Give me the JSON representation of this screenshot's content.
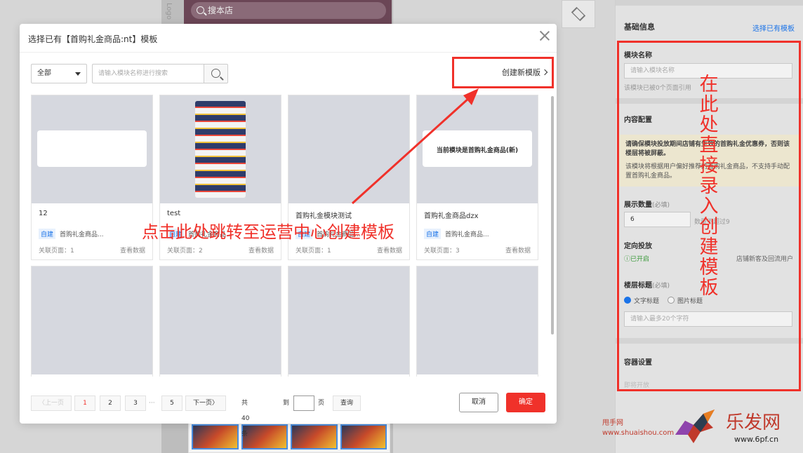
{
  "background": {
    "logo_text": "Logo",
    "search_placeholder": "搜本店",
    "layers_icon": "layers-icon"
  },
  "panel": {
    "title": "基础信息",
    "reuse_link": "选择已有模板",
    "module_name_label": "模块名称",
    "module_name_placeholder": "请输入模块名称",
    "referenced_note": "该模块已被0个页面引用",
    "content_config_label": "内容配置",
    "notice_bold": "请确保模块投放期间店铺有生效的首购礼金优惠券，否则该楼层将被屏蔽。",
    "notice_normal": "该模块将根据用户偏好推荐的首购礼金商品，不支持手动配置首购礼金商品。",
    "display_count_label": "展示数量",
    "required_hint": "(必填)",
    "display_count_value": "6",
    "display_count_hint": "数量不超过9",
    "targeting_label": "定向投放",
    "targeting_status": "已开启",
    "targeting_audience": "店铺新客及回流用户",
    "floor_title_label": "楼层标题",
    "option_text_title": "文字标题",
    "option_image_title": "图片标题",
    "title_placeholder": "请输入最多20个字符",
    "container_label": "容器设置",
    "container_note": "即将开放"
  },
  "modal": {
    "title": "选择已有【首购礼金商品:nt】模板",
    "filter_value": "全部",
    "search_placeholder": "请输入模块名称进行搜索",
    "create_new": "创建新模版",
    "cards": [
      {
        "name": "12",
        "tag": "自建",
        "tag_text": "首购礼金商品...",
        "pages": "关联页面：1",
        "data_link": "查看数据",
        "preview": "banner",
        "banner_text": ""
      },
      {
        "name": "test",
        "tag": "自建",
        "tag_text": "首购礼金商品...",
        "pages": "关联页面：2",
        "data_link": "查看数据",
        "preview": "image",
        "banner_text": ""
      },
      {
        "name": "首购礼金模块测试",
        "tag": "自建",
        "tag_text": "首购礼金商品...",
        "pages": "关联页面：1",
        "data_link": "查看数据",
        "preview": "blank",
        "banner_text": ""
      },
      {
        "name": "首购礼金商品dzx",
        "tag": "自建",
        "tag_text": "首购礼金商品...",
        "pages": "关联页面：3",
        "data_link": "查看数据",
        "preview": "banner",
        "banner_text": "当前模块是首购礼金商品(新)"
      }
    ],
    "pagination": {
      "prev": "上一页",
      "pages": [
        "1",
        "2",
        "3",
        "5"
      ],
      "ellipsis": "···",
      "next": "下一页",
      "total": "共 40 条",
      "goto_prefix": "到",
      "goto_suffix": "页",
      "goto_button": "查询"
    },
    "cancel": "取消",
    "confirm": "确定"
  },
  "annotations": {
    "click_here": "点击此处跳转至运营中心创建模板",
    "direct_entry": "在此处直接录入创建模板",
    "color": "#f0312a"
  },
  "watermark": {
    "site_name": "甩手网",
    "site_url": "www.shuaishou.com",
    "brand": "乐发网",
    "brand_url": "www.6pf.cn"
  }
}
